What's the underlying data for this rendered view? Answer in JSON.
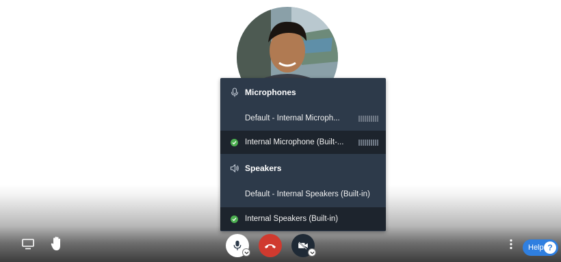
{
  "participant": {
    "avatar_icon": "participant-avatar"
  },
  "device_menu": {
    "microphones": {
      "header": "Microphones",
      "icon": "microphone-icon",
      "items": [
        {
          "label": "Default - Internal Microph...",
          "selected": false
        },
        {
          "label": "Internal Microphone (Built-...",
          "selected": true
        }
      ]
    },
    "speakers": {
      "header": "Speakers",
      "icon": "speaker-icon",
      "items": [
        {
          "label": "Default - Internal Speakers (Built-in)",
          "selected": false
        },
        {
          "label": "Internal Speakers (Built-in)",
          "selected": true
        }
      ]
    }
  },
  "toolbar": {
    "share_screen_icon": "screen-share-icon",
    "raise_hand_icon": "raise-hand-icon",
    "mic_icon": "microphone-icon",
    "hangup_icon": "phone-hangup-icon",
    "video_icon": "video-off-icon",
    "more_icon": "more-vertical-icon",
    "help_label": "Help",
    "help_icon_glyph": "?"
  },
  "colors": {
    "menu_bg": "#2d3a4a",
    "menu_selected_bg": "#1d242d",
    "check_green": "#4caf50",
    "hangup_red": "#d03a2f",
    "help_blue": "#2f7fe0"
  }
}
